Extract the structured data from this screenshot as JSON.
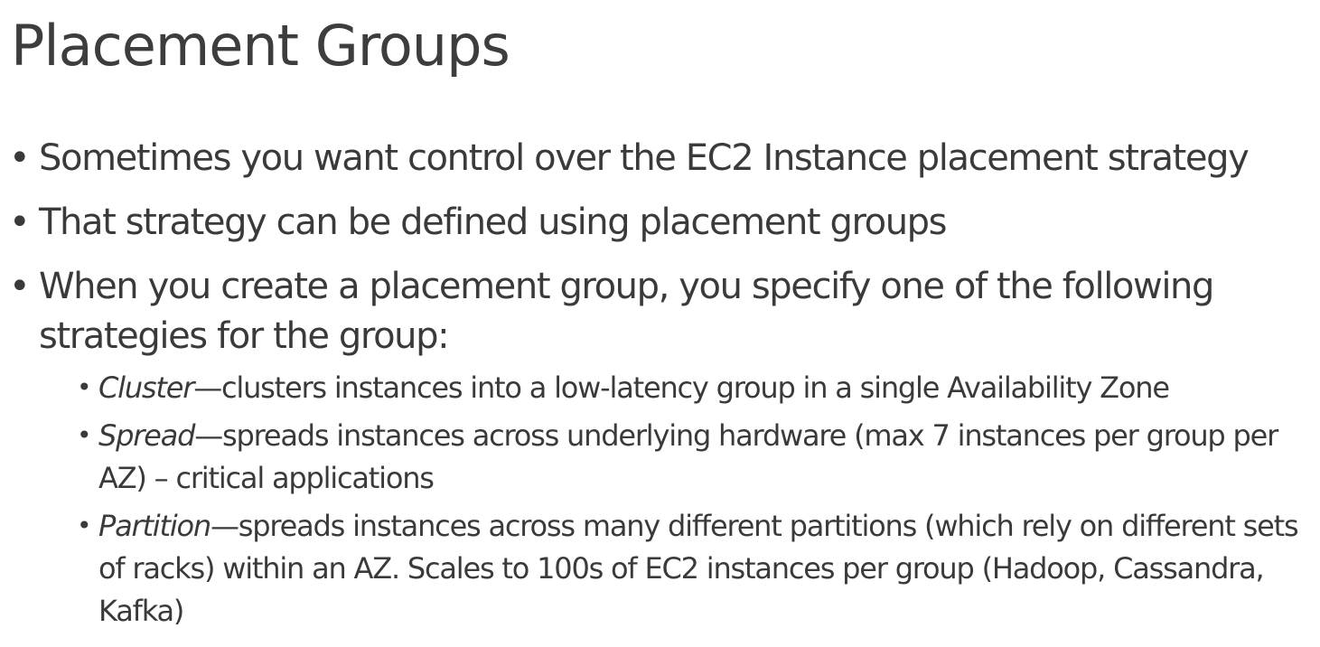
{
  "title": "Placement Groups",
  "bullets": [
    "Sometimes you want control over the EC2 Instance placement strategy",
    "That strategy can be defined using placement groups",
    "When you create a placement group, you specify one of the following strategies for the group:"
  ],
  "strategies": [
    {
      "name": "Cluster",
      "desc": "—clusters instances into a low-latency group in a single Availability Zone"
    },
    {
      "name": "Spread",
      "desc": "—spreads instances across underlying hardware (max 7 instances per group per AZ) – critical applications"
    },
    {
      "name": "Partition",
      "desc": "—spreads instances across many different partitions (which rely on different sets of racks) within an AZ. Scales to 100s of EC2 instances per group (Hadoop, Cassandra, Kafka)"
    }
  ]
}
